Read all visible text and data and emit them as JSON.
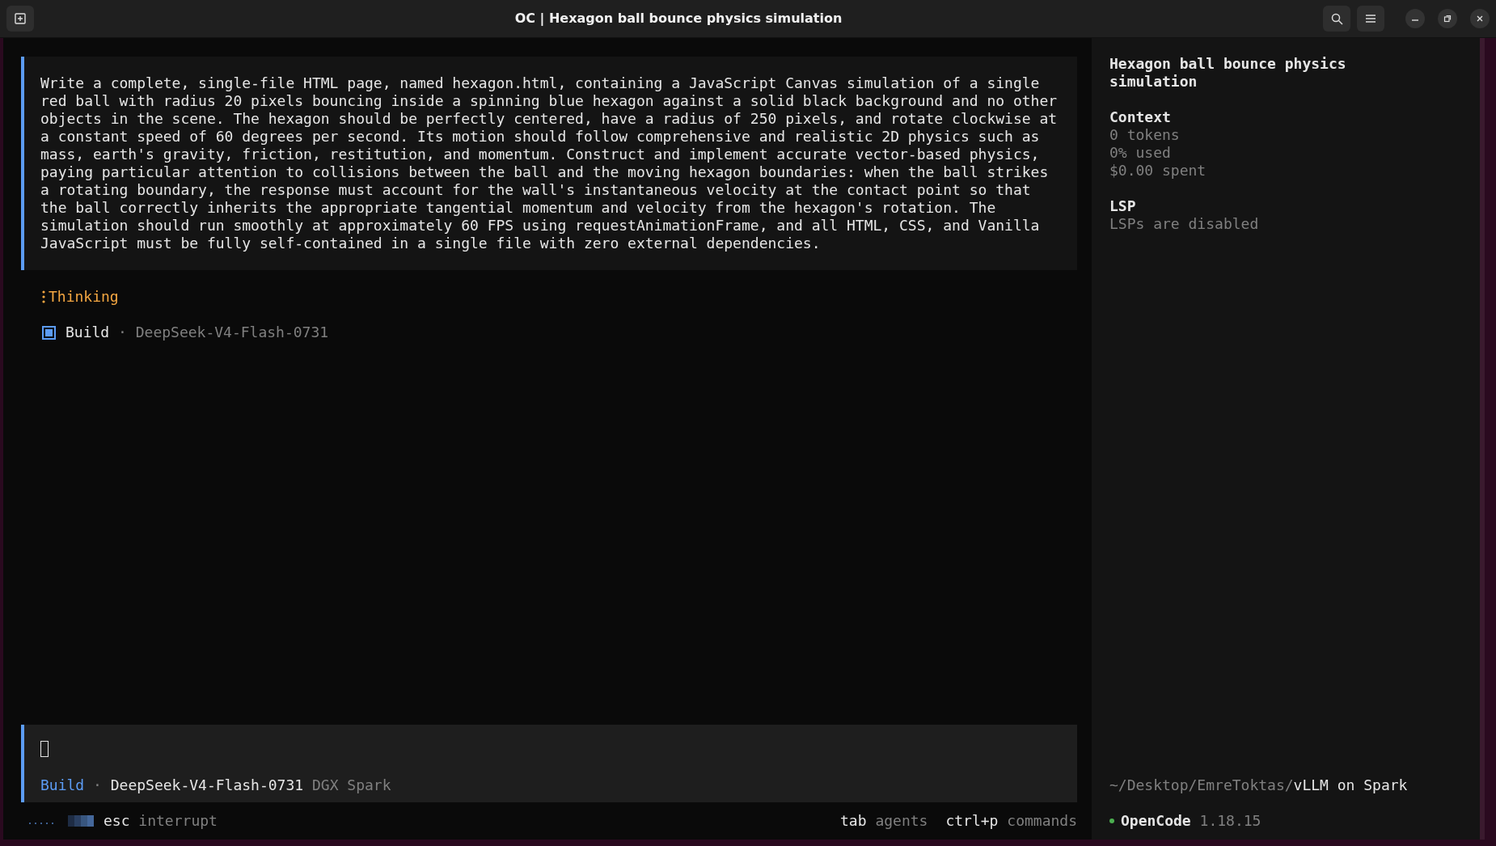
{
  "window": {
    "title": "OC | Hexagon ball bounce physics simulation"
  },
  "prompt": {
    "text": "Write a complete, single-file HTML page, named hexagon.html, containing a JavaScript Canvas simulation of a single red ball with radius 20 pixels bouncing inside a spinning blue hexagon against a solid black background and no other objects in the scene. The hexagon should be perfectly centered, have a radius of 250 pixels, and rotate clockwise at a constant speed of 60 degrees per second. Its motion should follow comprehensive and realistic 2D physics such as mass, earth's gravity, friction, restitution, and momentum. Construct and implement accurate vector-based physics, paying particular attention to collisions between the ball and the moving hexagon boundaries: when the ball strikes a rotating boundary, the response must account for the wall's instantaneous velocity at the contact point so that the ball correctly inherits the appropriate tangential momentum and velocity from the hexagon's rotation. The simulation should run smoothly at approximately 60 FPS using requestAnimationFrame, and all HTML, CSS, and Vanilla JavaScript must be fully self-contained in a single file with zero external dependencies."
  },
  "thinking": {
    "label": "Thinking"
  },
  "agent_line": {
    "agent": "Build",
    "separator": "·",
    "model": "DeepSeek-V4-Flash-0731"
  },
  "input": {
    "agent": "Build",
    "separator": "·",
    "model": "DeepSeek-V4-Flash-0731",
    "provider": "DGX Spark"
  },
  "footer": {
    "left": [
      {
        "key": "esc",
        "action": "interrupt"
      }
    ],
    "right": [
      {
        "key": "tab",
        "action": "agents"
      },
      {
        "key": "ctrl+p",
        "action": "commands"
      }
    ]
  },
  "sidebar": {
    "title": "Hexagon ball bounce physics simulation",
    "sections": [
      {
        "heading": "Context",
        "lines": [
          "0 tokens",
          "0% used",
          "$0.00 spent"
        ]
      },
      {
        "heading": "LSP",
        "lines": [
          "LSPs are disabled"
        ]
      }
    ],
    "path": {
      "dim": "~/Desktop/EmreToktas/",
      "bright": "vLLM on Spark"
    },
    "app": {
      "name": "OpenCode",
      "version": "1.18.15",
      "color": "#4caf50"
    }
  }
}
